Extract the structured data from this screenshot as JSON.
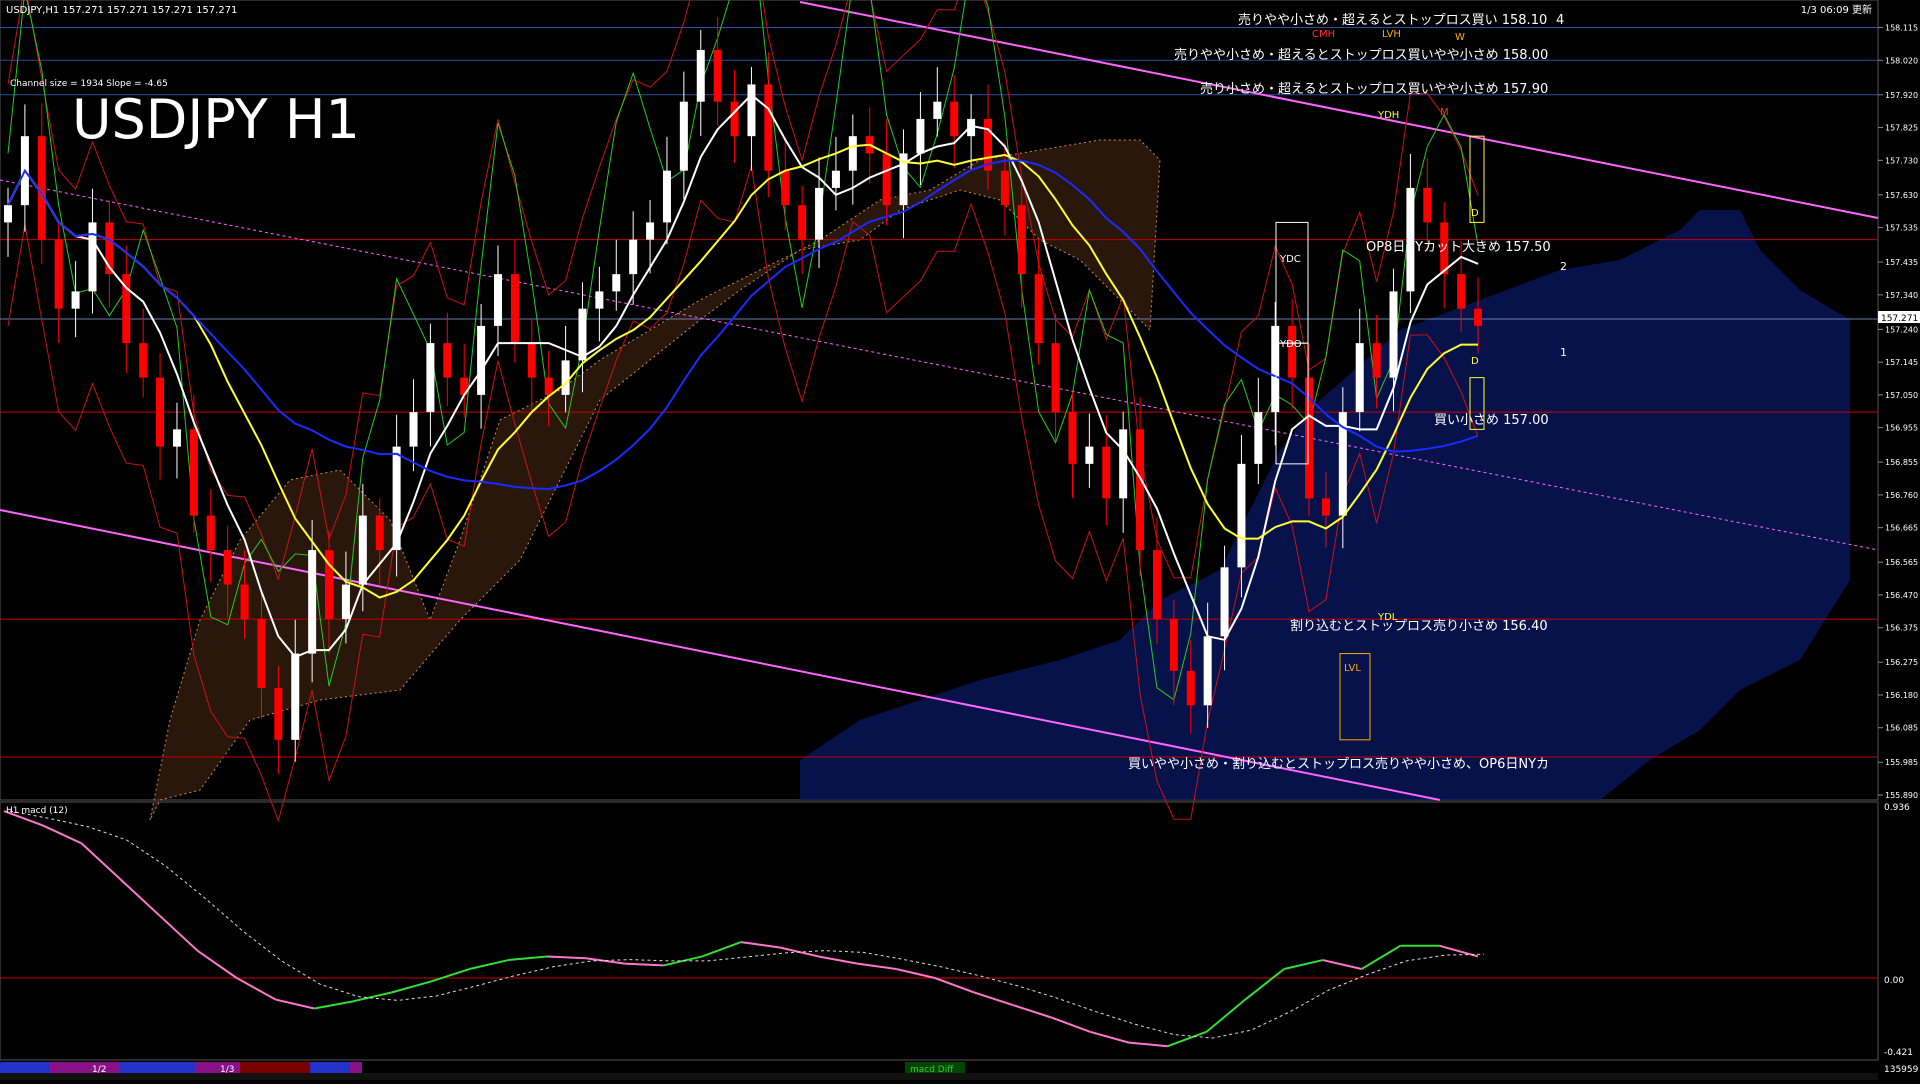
{
  "header": {
    "symbol_info": "USDJPY,H1  157.271 157.271 157.271 157.271",
    "datetime": "1/3 06:09 更新",
    "channel_info": "Channel size = 1934 Slope = -4.65",
    "big_title": "USDJPY H1"
  },
  "annotations": {
    "a1": "売りやや小さめ・超えるとストップロス買い 158.10",
    "a1_suffix": "4",
    "a2": "売りやや小さめ・超えるとストップロス買いやや小さめ 158.00",
    "a3": "売り小さめ・超えるとストップロス買いやや小さめ 157.90",
    "a4": "OP8日NYカット大きめ 157.50",
    "a5": "買い小さめ 157.00",
    "a6": "割り込むとストップロス売り小さめ 156.40",
    "a7": "買いやや小さめ・割り込むとストップロス売りやや小さめ、OP6日NYカ"
  },
  "box_labels": {
    "ydc": "YDC",
    "ydo": "YDO",
    "ydh": "YDH",
    "ydl": "YDL",
    "lvh": "LVH",
    "lvl": "LVL",
    "cmh": "CMH",
    "w": "W",
    "m": "M",
    "d": "D",
    "n1": "1",
    "n2": "2"
  },
  "macd_panel": {
    "label": "H1  macd (12)",
    "scale_top": "0.936",
    "scale_zero": "0.00",
    "scale_bottom": "-0.421"
  },
  "bottom_bar": {
    "date_labels": [
      "1/2",
      "1/3"
    ],
    "indicator_label": "macd Diff",
    "right_value": "135959"
  },
  "current_price": "157.271",
  "colors": {
    "background": "#000000",
    "bull_candle": "#ffffff",
    "bear_candle": "#ff0000",
    "ma_white": "#ffffff",
    "ma_yellow": "#ffff33",
    "ma_blue": "#1a2bff",
    "channel": "#ff66ff",
    "macd_up": "#33dd33",
    "macd_down": "#ff77cc"
  },
  "chart_data": {
    "type": "candlestick",
    "symbol": "USDJPY",
    "timeframe": "H1",
    "ylim": [
      155.89,
      158.16
    ],
    "y_ticks": [
      158.115,
      158.02,
      157.92,
      157.825,
      157.73,
      157.63,
      157.535,
      157.435,
      157.34,
      157.24,
      157.145,
      157.05,
      156.955,
      156.855,
      156.76,
      156.665,
      156.565,
      156.47,
      156.375,
      156.275,
      156.18,
      156.085,
      155.985,
      155.89
    ],
    "horizontal_levels": [
      158.1,
      158.0,
      157.9,
      157.5,
      157.0,
      156.4,
      156.0
    ],
    "close_path": [
      157.6,
      157.8,
      157.5,
      157.3,
      157.35,
      157.55,
      157.4,
      157.2,
      157.1,
      156.9,
      156.95,
      156.7,
      156.6,
      156.5,
      156.4,
      156.2,
      156.05,
      156.3,
      156.6,
      156.4,
      156.5,
      156.7,
      156.6,
      156.9,
      157.0,
      157.2,
      157.1,
      157.05,
      157.25,
      157.4,
      157.2,
      157.1,
      157.05,
      157.15,
      157.3,
      157.35,
      157.4,
      157.5,
      157.55,
      157.7,
      157.9,
      158.05,
      157.9,
      157.8,
      157.95,
      157.7,
      157.6,
      157.5,
      157.65,
      157.7,
      157.8,
      157.75,
      157.6,
      157.75,
      157.85,
      157.9,
      157.8,
      157.85,
      157.7,
      157.6,
      157.4,
      157.2,
      157.0,
      156.85,
      156.9,
      156.75,
      156.95,
      156.6,
      156.4,
      156.25,
      156.15,
      156.35,
      156.55,
      156.85,
      157.0,
      157.25,
      157.1,
      156.75,
      156.7,
      157.0,
      157.2,
      157.1,
      157.35,
      157.65,
      157.55,
      157.4,
      157.3,
      157.25
    ],
    "macd_main": [
      0.93,
      0.85,
      0.75,
      0.55,
      0.35,
      0.15,
      0.0,
      -0.12,
      -0.17,
      -0.13,
      -0.08,
      -0.02,
      0.05,
      0.1,
      0.12,
      0.11,
      0.08,
      0.07,
      0.12,
      0.2,
      0.17,
      0.12,
      0.08,
      0.05,
      0.0,
      -0.08,
      -0.15,
      -0.22,
      -0.3,
      -0.36,
      -0.38,
      -0.3,
      -0.12,
      0.05,
      0.1,
      0.05,
      0.18,
      0.18,
      0.12
    ]
  }
}
